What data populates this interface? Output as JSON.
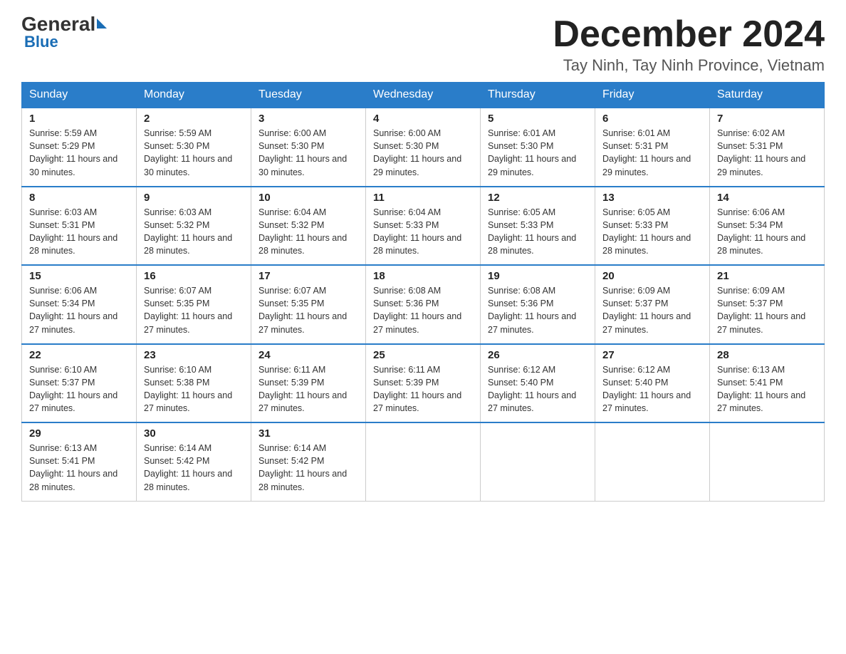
{
  "header": {
    "logo": {
      "general": "General",
      "blue": "Blue"
    },
    "title": "December 2024",
    "location": "Tay Ninh, Tay Ninh Province, Vietnam"
  },
  "days_of_week": [
    "Sunday",
    "Monday",
    "Tuesday",
    "Wednesday",
    "Thursday",
    "Friday",
    "Saturday"
  ],
  "weeks": [
    [
      {
        "day": "1",
        "sunrise": "Sunrise: 5:59 AM",
        "sunset": "Sunset: 5:29 PM",
        "daylight": "Daylight: 11 hours and 30 minutes."
      },
      {
        "day": "2",
        "sunrise": "Sunrise: 5:59 AM",
        "sunset": "Sunset: 5:30 PM",
        "daylight": "Daylight: 11 hours and 30 minutes."
      },
      {
        "day": "3",
        "sunrise": "Sunrise: 6:00 AM",
        "sunset": "Sunset: 5:30 PM",
        "daylight": "Daylight: 11 hours and 30 minutes."
      },
      {
        "day": "4",
        "sunrise": "Sunrise: 6:00 AM",
        "sunset": "Sunset: 5:30 PM",
        "daylight": "Daylight: 11 hours and 29 minutes."
      },
      {
        "day": "5",
        "sunrise": "Sunrise: 6:01 AM",
        "sunset": "Sunset: 5:30 PM",
        "daylight": "Daylight: 11 hours and 29 minutes."
      },
      {
        "day": "6",
        "sunrise": "Sunrise: 6:01 AM",
        "sunset": "Sunset: 5:31 PM",
        "daylight": "Daylight: 11 hours and 29 minutes."
      },
      {
        "day": "7",
        "sunrise": "Sunrise: 6:02 AM",
        "sunset": "Sunset: 5:31 PM",
        "daylight": "Daylight: 11 hours and 29 minutes."
      }
    ],
    [
      {
        "day": "8",
        "sunrise": "Sunrise: 6:03 AM",
        "sunset": "Sunset: 5:31 PM",
        "daylight": "Daylight: 11 hours and 28 minutes."
      },
      {
        "day": "9",
        "sunrise": "Sunrise: 6:03 AM",
        "sunset": "Sunset: 5:32 PM",
        "daylight": "Daylight: 11 hours and 28 minutes."
      },
      {
        "day": "10",
        "sunrise": "Sunrise: 6:04 AM",
        "sunset": "Sunset: 5:32 PM",
        "daylight": "Daylight: 11 hours and 28 minutes."
      },
      {
        "day": "11",
        "sunrise": "Sunrise: 6:04 AM",
        "sunset": "Sunset: 5:33 PM",
        "daylight": "Daylight: 11 hours and 28 minutes."
      },
      {
        "day": "12",
        "sunrise": "Sunrise: 6:05 AM",
        "sunset": "Sunset: 5:33 PM",
        "daylight": "Daylight: 11 hours and 28 minutes."
      },
      {
        "day": "13",
        "sunrise": "Sunrise: 6:05 AM",
        "sunset": "Sunset: 5:33 PM",
        "daylight": "Daylight: 11 hours and 28 minutes."
      },
      {
        "day": "14",
        "sunrise": "Sunrise: 6:06 AM",
        "sunset": "Sunset: 5:34 PM",
        "daylight": "Daylight: 11 hours and 28 minutes."
      }
    ],
    [
      {
        "day": "15",
        "sunrise": "Sunrise: 6:06 AM",
        "sunset": "Sunset: 5:34 PM",
        "daylight": "Daylight: 11 hours and 27 minutes."
      },
      {
        "day": "16",
        "sunrise": "Sunrise: 6:07 AM",
        "sunset": "Sunset: 5:35 PM",
        "daylight": "Daylight: 11 hours and 27 minutes."
      },
      {
        "day": "17",
        "sunrise": "Sunrise: 6:07 AM",
        "sunset": "Sunset: 5:35 PM",
        "daylight": "Daylight: 11 hours and 27 minutes."
      },
      {
        "day": "18",
        "sunrise": "Sunrise: 6:08 AM",
        "sunset": "Sunset: 5:36 PM",
        "daylight": "Daylight: 11 hours and 27 minutes."
      },
      {
        "day": "19",
        "sunrise": "Sunrise: 6:08 AM",
        "sunset": "Sunset: 5:36 PM",
        "daylight": "Daylight: 11 hours and 27 minutes."
      },
      {
        "day": "20",
        "sunrise": "Sunrise: 6:09 AM",
        "sunset": "Sunset: 5:37 PM",
        "daylight": "Daylight: 11 hours and 27 minutes."
      },
      {
        "day": "21",
        "sunrise": "Sunrise: 6:09 AM",
        "sunset": "Sunset: 5:37 PM",
        "daylight": "Daylight: 11 hours and 27 minutes."
      }
    ],
    [
      {
        "day": "22",
        "sunrise": "Sunrise: 6:10 AM",
        "sunset": "Sunset: 5:37 PM",
        "daylight": "Daylight: 11 hours and 27 minutes."
      },
      {
        "day": "23",
        "sunrise": "Sunrise: 6:10 AM",
        "sunset": "Sunset: 5:38 PM",
        "daylight": "Daylight: 11 hours and 27 minutes."
      },
      {
        "day": "24",
        "sunrise": "Sunrise: 6:11 AM",
        "sunset": "Sunset: 5:39 PM",
        "daylight": "Daylight: 11 hours and 27 minutes."
      },
      {
        "day": "25",
        "sunrise": "Sunrise: 6:11 AM",
        "sunset": "Sunset: 5:39 PM",
        "daylight": "Daylight: 11 hours and 27 minutes."
      },
      {
        "day": "26",
        "sunrise": "Sunrise: 6:12 AM",
        "sunset": "Sunset: 5:40 PM",
        "daylight": "Daylight: 11 hours and 27 minutes."
      },
      {
        "day": "27",
        "sunrise": "Sunrise: 6:12 AM",
        "sunset": "Sunset: 5:40 PM",
        "daylight": "Daylight: 11 hours and 27 minutes."
      },
      {
        "day": "28",
        "sunrise": "Sunrise: 6:13 AM",
        "sunset": "Sunset: 5:41 PM",
        "daylight": "Daylight: 11 hours and 27 minutes."
      }
    ],
    [
      {
        "day": "29",
        "sunrise": "Sunrise: 6:13 AM",
        "sunset": "Sunset: 5:41 PM",
        "daylight": "Daylight: 11 hours and 28 minutes."
      },
      {
        "day": "30",
        "sunrise": "Sunrise: 6:14 AM",
        "sunset": "Sunset: 5:42 PM",
        "daylight": "Daylight: 11 hours and 28 minutes."
      },
      {
        "day": "31",
        "sunrise": "Sunrise: 6:14 AM",
        "sunset": "Sunset: 5:42 PM",
        "daylight": "Daylight: 11 hours and 28 minutes."
      },
      null,
      null,
      null,
      null
    ]
  ]
}
